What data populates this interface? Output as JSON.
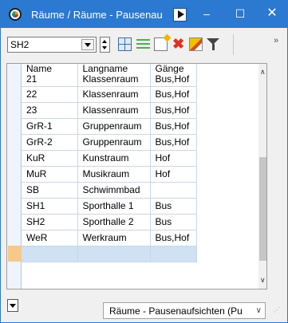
{
  "window": {
    "title": "Räume / Räume - Pausenau",
    "minimize": "–",
    "maximize": "☐",
    "close": "✕"
  },
  "toolbar": {
    "selected_room": "SH2",
    "overflow": "»"
  },
  "table": {
    "headers": [
      "Name",
      "Langname",
      "Gänge"
    ],
    "rows": [
      [
        "21",
        "Klassenraum",
        "Bus,Hof"
      ],
      [
        "22",
        "Klassenraum",
        "Bus,Hof"
      ],
      [
        "23",
        "Klassenraum",
        "Bus,Hof"
      ],
      [
        "GrR-1",
        "Gruppenraum",
        "Bus,Hof"
      ],
      [
        "GrR-2",
        "Gruppenraum",
        "Bus,Hof"
      ],
      [
        "KuR",
        "Kunstraum",
        "Hof"
      ],
      [
        "MuR",
        "Musikraum",
        "Hof"
      ],
      [
        "SB",
        "Schwimmbad",
        ""
      ],
      [
        "SH1",
        "Sporthalle 1",
        "Bus"
      ],
      [
        "SH2",
        "Sporthalle 2",
        "Bus"
      ],
      [
        "WeR",
        "Werkraum",
        "Bus,Hof"
      ]
    ]
  },
  "statusbar": {
    "view": "Räume - Pausenaufsichten (Pu"
  },
  "colors": {
    "titlebar": "#2b79d0",
    "new_row": "#cfe1f3",
    "new_row_marker": "#f6c98a",
    "grid_lines": "#c7d7e9"
  },
  "icons": [
    "app-icon",
    "grid-icon",
    "list-icon",
    "new-icon",
    "delete-icon",
    "edit-icon",
    "filter-icon"
  ]
}
